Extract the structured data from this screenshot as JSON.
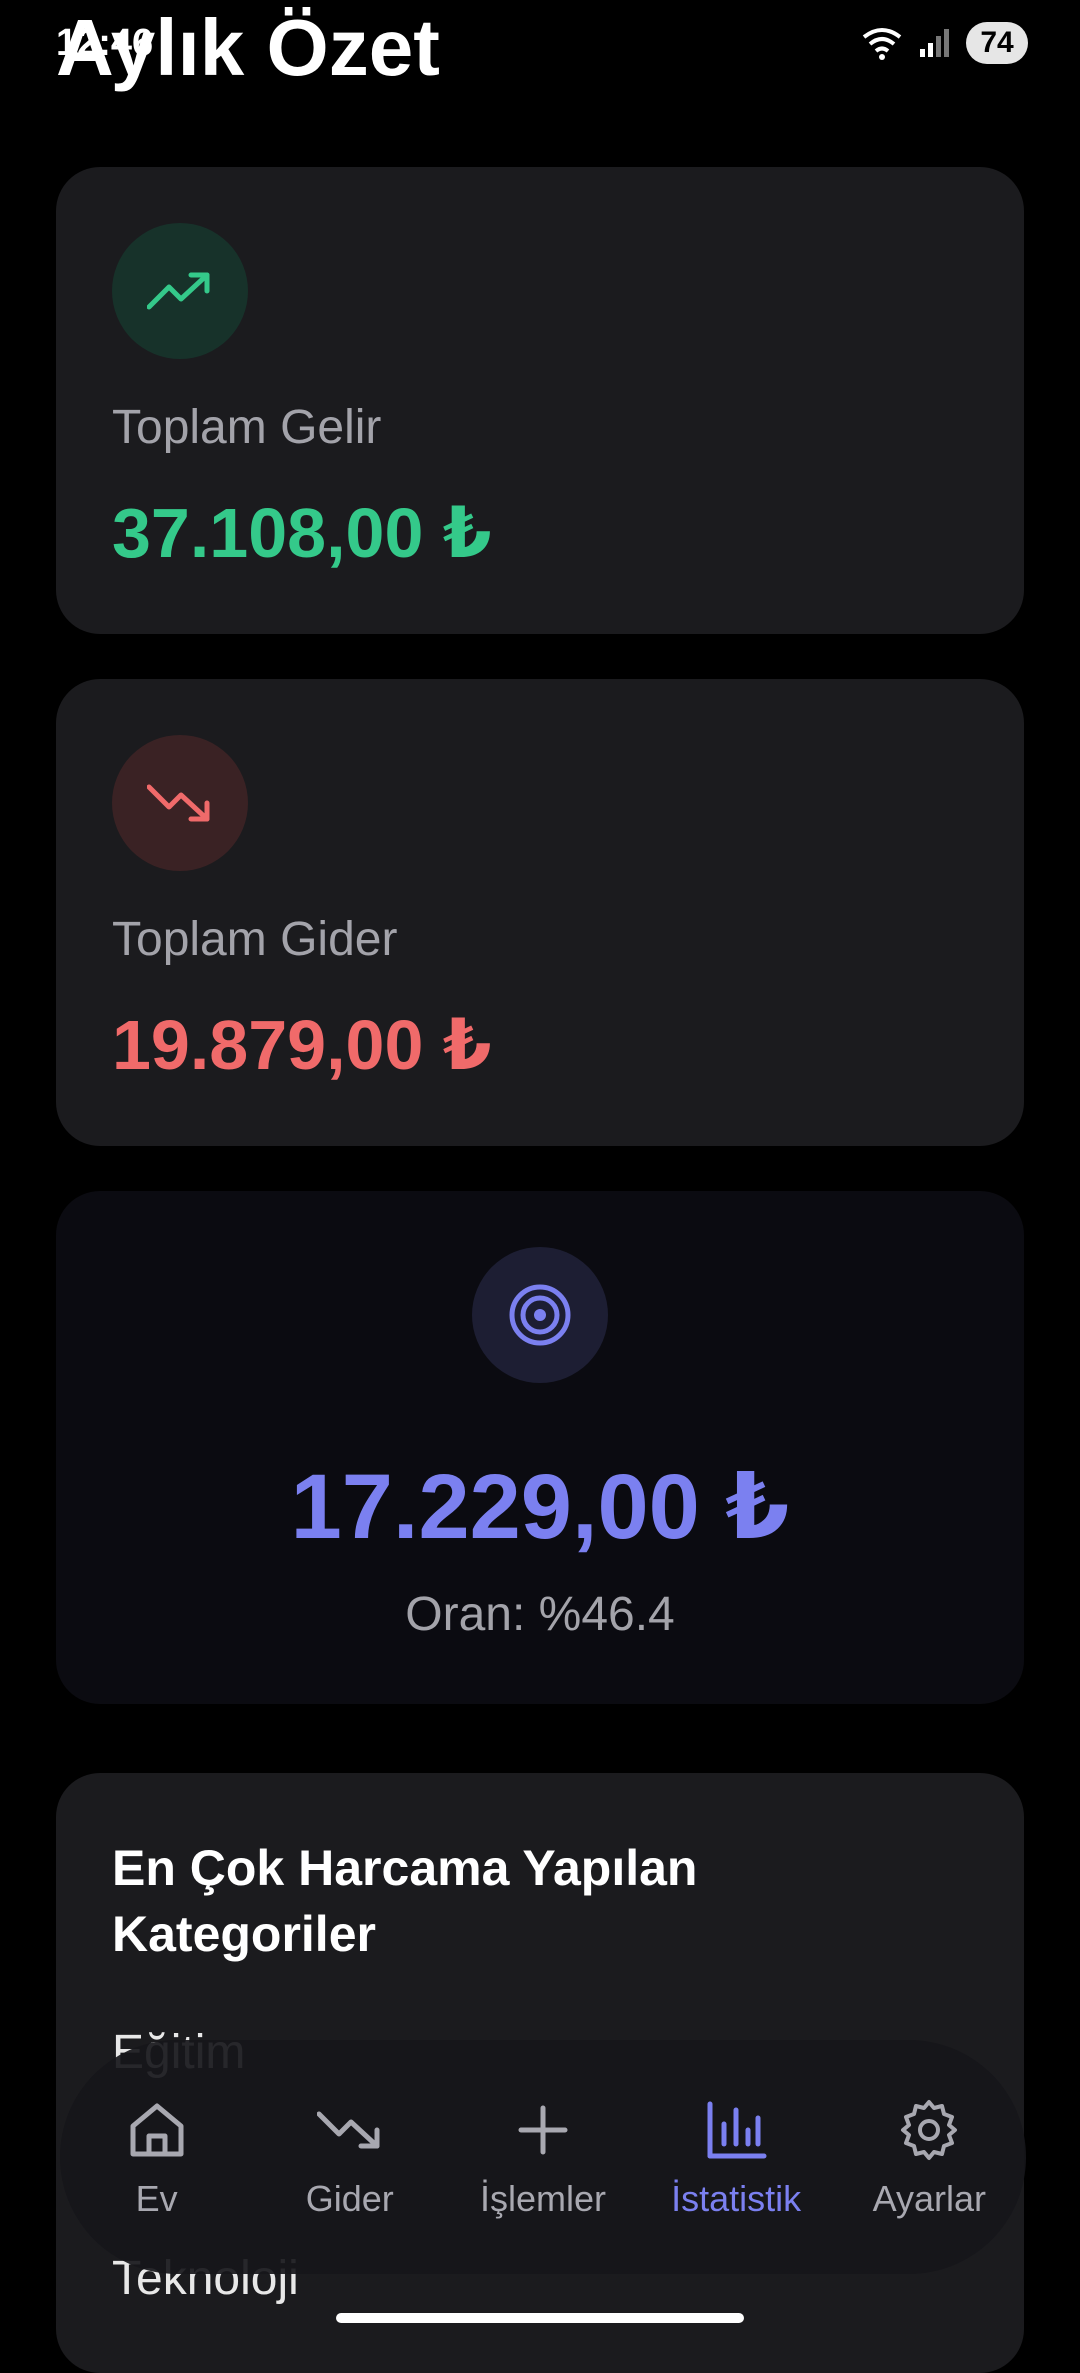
{
  "status_bar": {
    "time": "12:46",
    "battery": "74"
  },
  "header": {
    "title": "Aylık Özet"
  },
  "income": {
    "label": "Toplam Gelir",
    "amount": "37.108,00 ₺",
    "color": "#34c98a"
  },
  "expense": {
    "label": "Toplam Gider",
    "amount": "19.879,00 ₺",
    "color": "#f06a6a"
  },
  "net": {
    "amount": "17.229,00 ₺",
    "ratio": "Oran: %46.4",
    "color": "#7b80f0"
  },
  "categories": {
    "title": "En Çok Harcama Yapılan Kategoriler",
    "items": [
      "Eğitim",
      "Teknoloji"
    ]
  },
  "nav": {
    "items": [
      {
        "label": "Ev",
        "icon": "home-icon"
      },
      {
        "label": "Gider",
        "icon": "trending-down-icon"
      },
      {
        "label": "İşlemler",
        "icon": "plus-icon"
      },
      {
        "label": "İstatistik",
        "icon": "bar-chart-icon"
      },
      {
        "label": "Ayarlar",
        "icon": "gear-icon"
      }
    ],
    "active_index": 3
  }
}
